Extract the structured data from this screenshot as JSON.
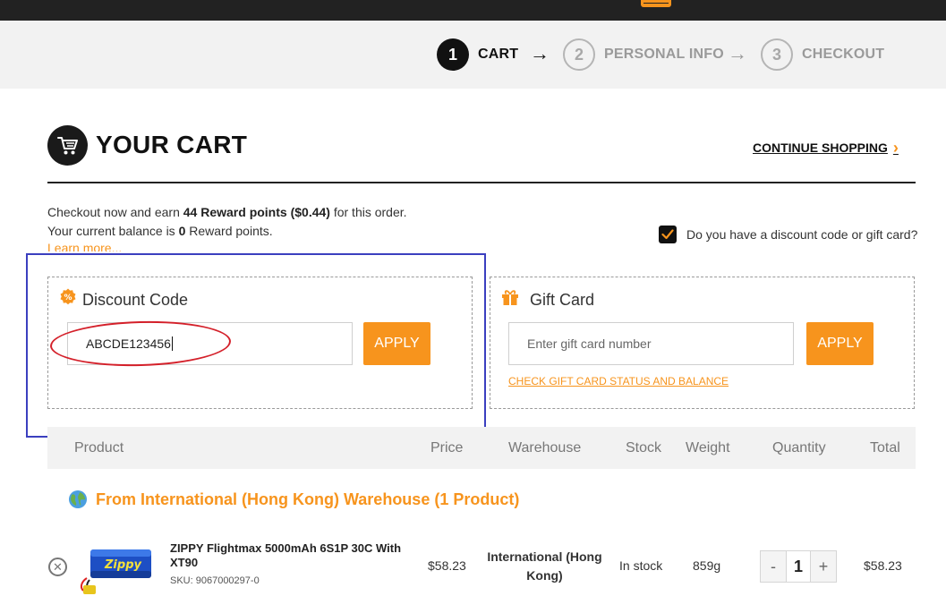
{
  "steps": [
    {
      "num": "1",
      "label": "CART"
    },
    {
      "num": "2",
      "label": "PERSONAL INFO"
    },
    {
      "num": "3",
      "label": "CHECKOUT"
    }
  ],
  "header": {
    "title": "YOUR CART",
    "continue_label": "CONTINUE SHOPPING"
  },
  "rewards": {
    "line1_prefix": "Checkout now and earn ",
    "points": "44 Reward points",
    "value": "($0.44)",
    "line1_suffix": " for this order.",
    "line2_prefix": "Your current balance is ",
    "balance": "0",
    "line2_suffix": " Reward points.",
    "learn_more": "Learn more..."
  },
  "discount_toggle": {
    "checked": true,
    "label": "Do you have a discount code or gift card?"
  },
  "discount_code": {
    "title": "Discount Code",
    "value": "ABCDE123456",
    "apply_label": "APPLY"
  },
  "gift_card": {
    "title": "Gift Card",
    "placeholder": "Enter gift card number",
    "apply_label": "APPLY",
    "check_link": "CHECK GIFT CARD STATUS AND BALANCE"
  },
  "table": {
    "columns": [
      "Product",
      "Price",
      "Warehouse",
      "Stock",
      "Weight",
      "Quantity",
      "Total"
    ]
  },
  "warehouse_group": {
    "label": "From International (Hong Kong) Warehouse (1 Product)"
  },
  "cart_items": [
    {
      "name": "ZIPPY Flightmax 5000mAh 6S1P 30C With XT90",
      "sku": "SKU: 9067000297-0",
      "price": "$58.23",
      "warehouse": "International (Hong Kong)",
      "stock": "In stock",
      "weight": "859g",
      "quantity": "1",
      "total": "$58.23",
      "thumb_brand": "Zippy"
    }
  ],
  "qty_controls": {
    "minus": "-",
    "plus": "+"
  },
  "colors": {
    "accent": "#f7941d",
    "dark": "#111111",
    "annotation_box": "#3b3fbf",
    "annotation_ellipse": "#d4202a"
  }
}
